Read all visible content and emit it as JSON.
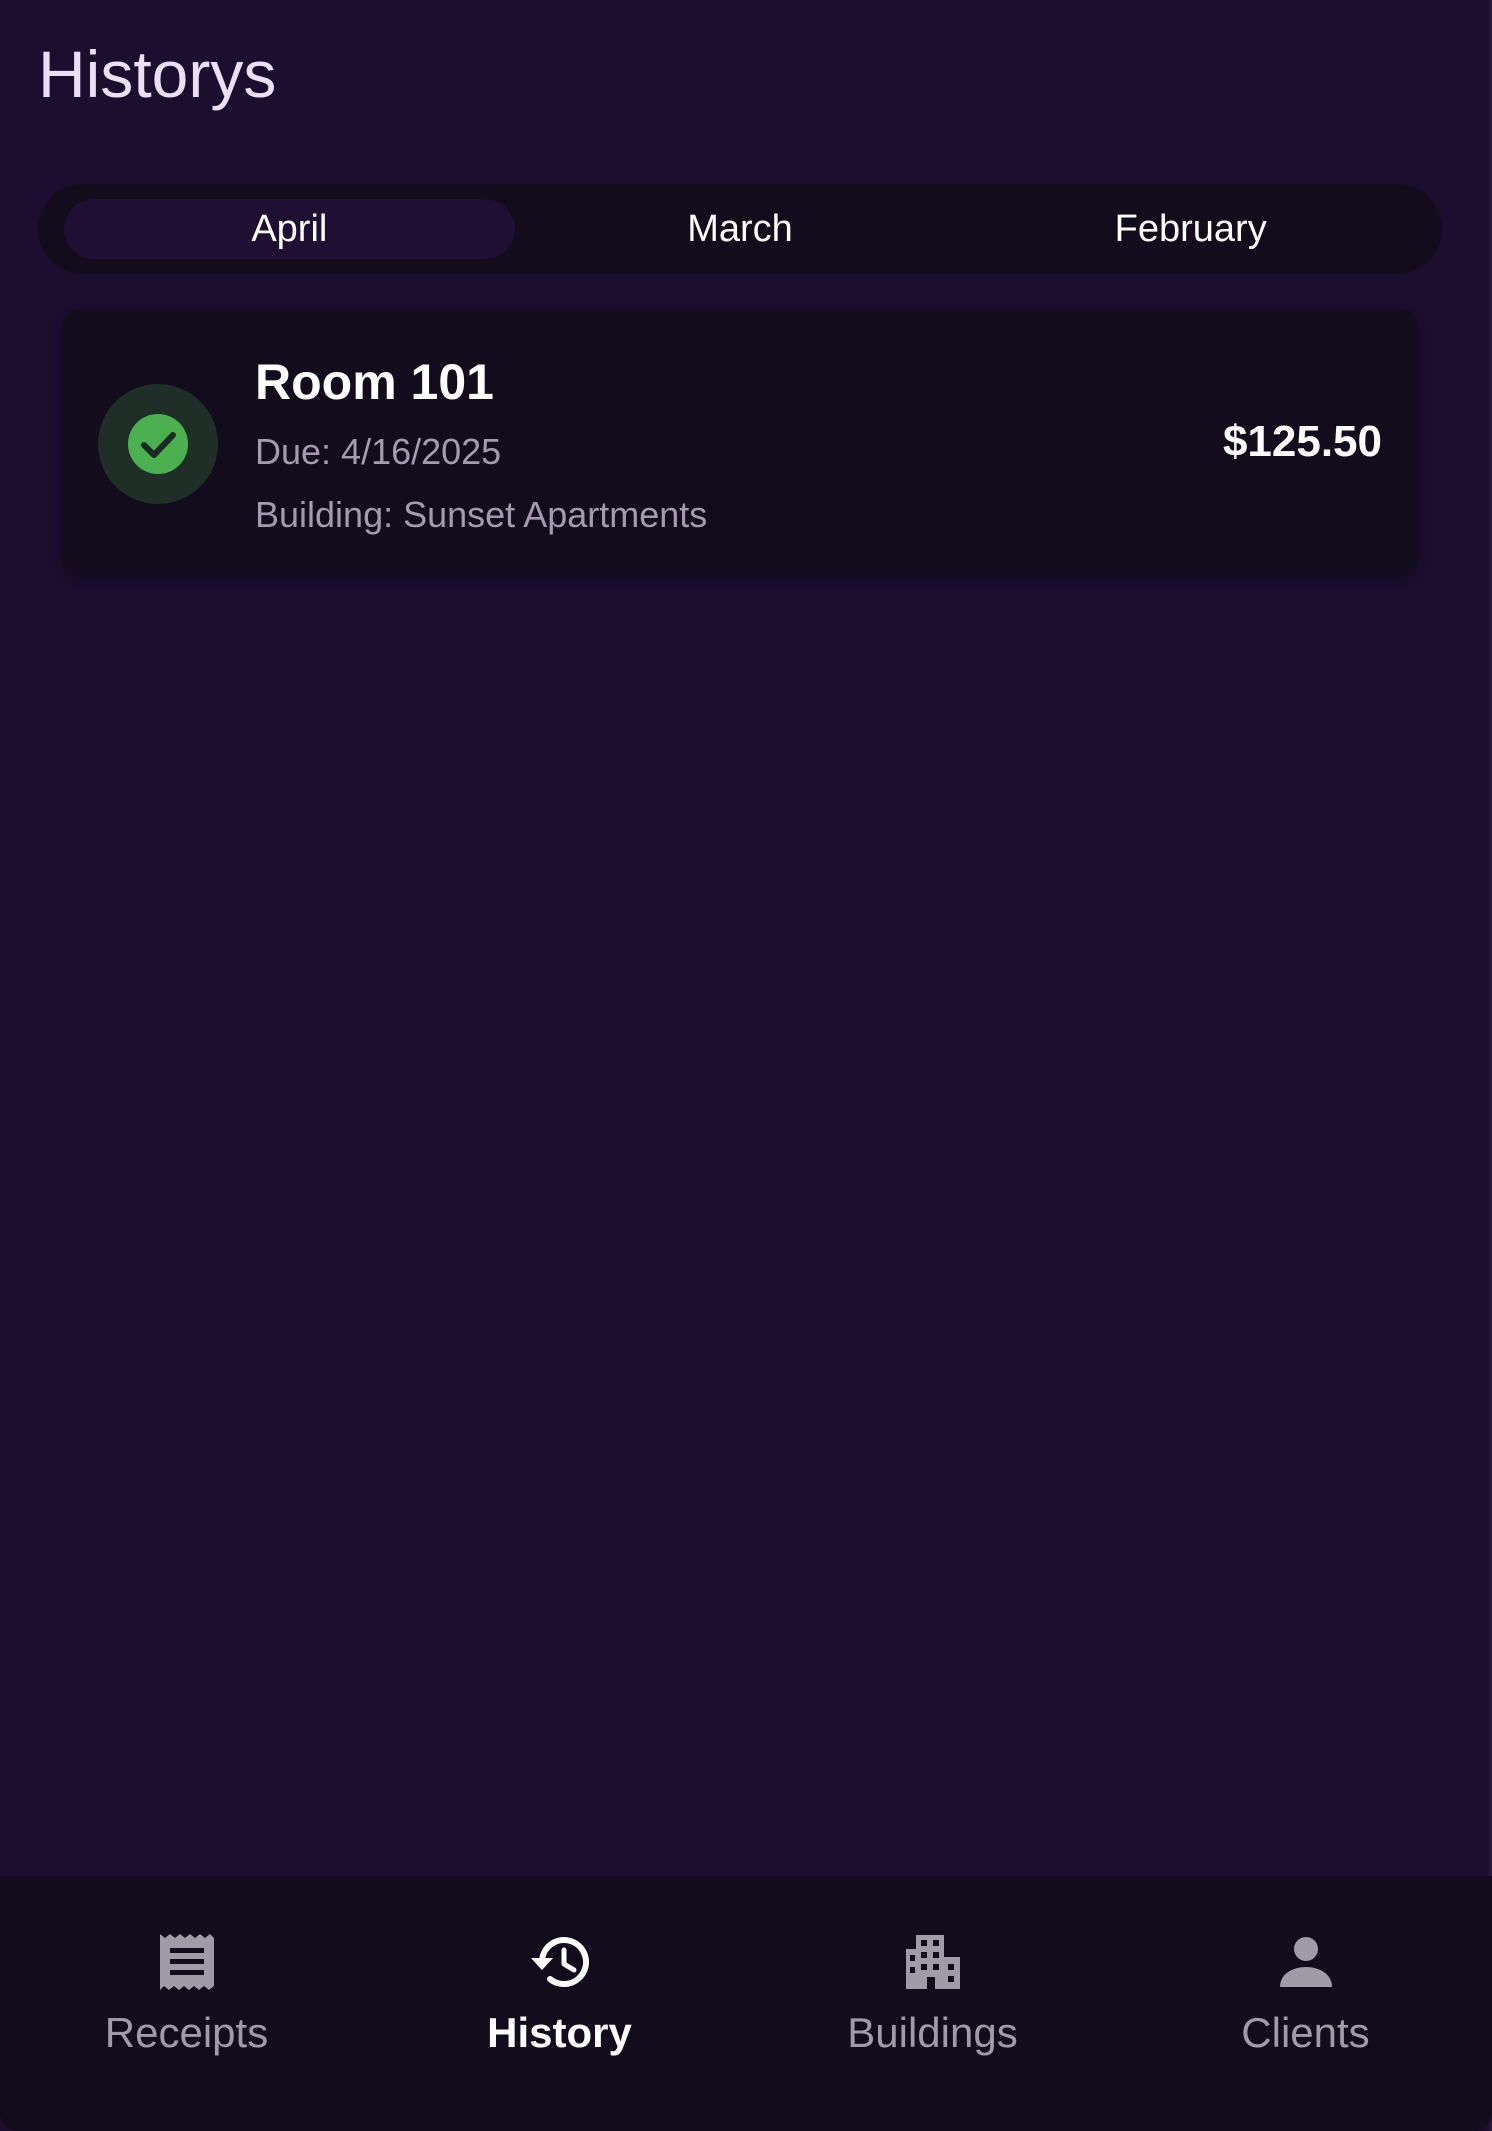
{
  "header": {
    "title": "Historys"
  },
  "tabs": [
    {
      "label": "April",
      "active": true
    },
    {
      "label": "March",
      "active": false
    },
    {
      "label": "February",
      "active": false
    }
  ],
  "records": [
    {
      "room": "Room 101",
      "due": "Due: 4/16/2025",
      "building": "Building: Sunset Apartments",
      "amount": "$125.50",
      "status_icon": "check-circle-icon",
      "status_color": "#4caf50"
    }
  ],
  "bottom_nav": [
    {
      "label": "Receipts",
      "icon": "receipt-icon",
      "active": false
    },
    {
      "label": "History",
      "icon": "history-icon",
      "active": true
    },
    {
      "label": "Buildings",
      "icon": "building-icon",
      "active": false
    },
    {
      "label": "Clients",
      "icon": "person-icon",
      "active": false
    }
  ],
  "colors": {
    "background": "#1b0e2e",
    "surface": "#120c1d",
    "success": "#4caf50",
    "muted_text": "#a49cae"
  }
}
